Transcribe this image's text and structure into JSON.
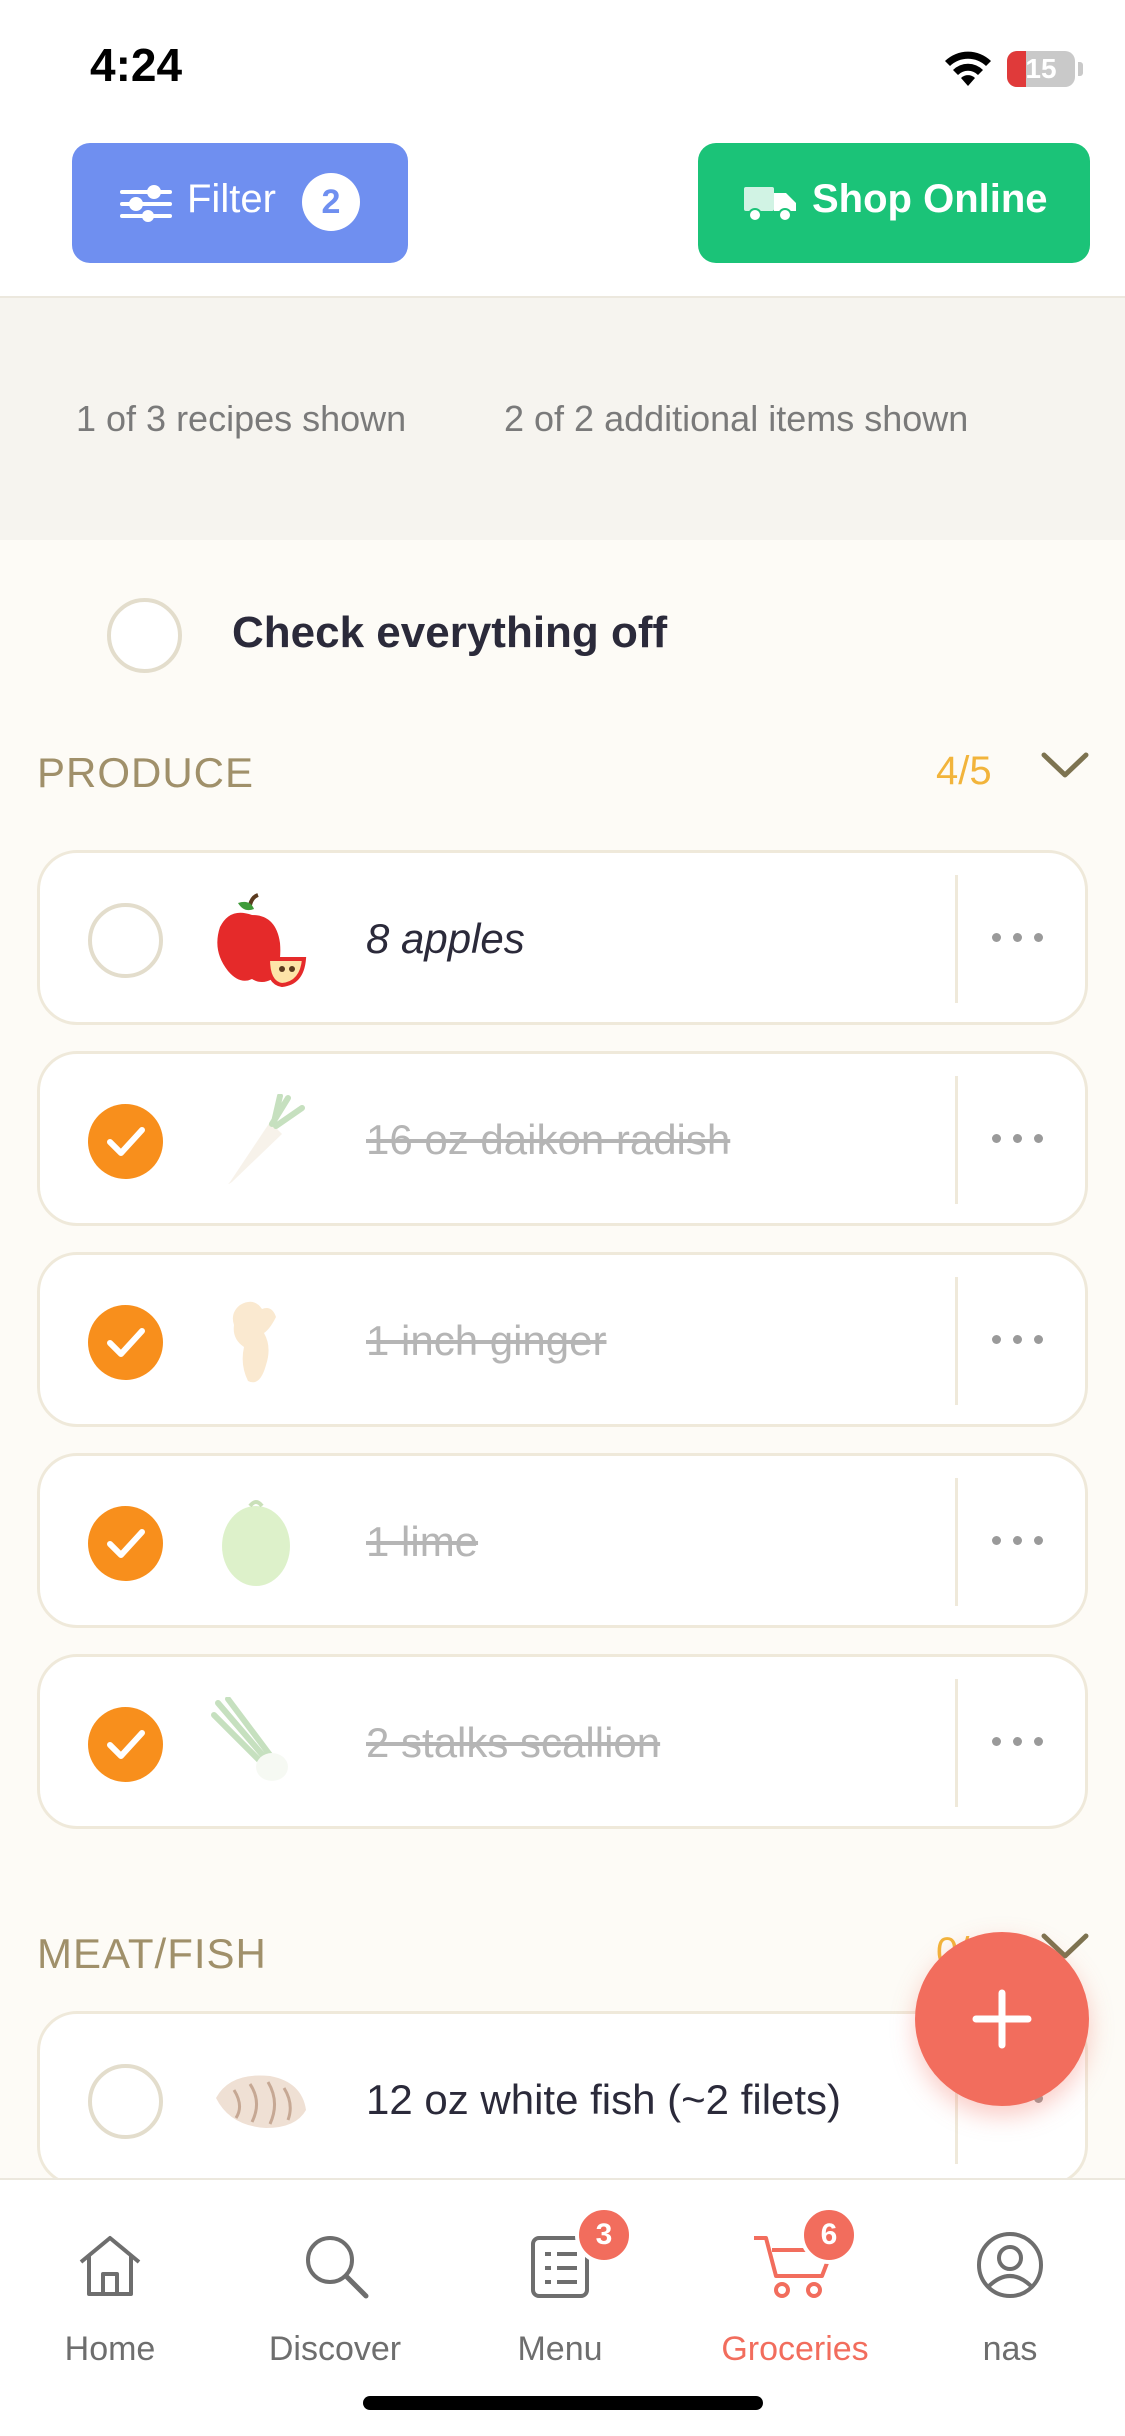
{
  "status_bar": {
    "time": "4:24",
    "battery_level": "15"
  },
  "toolbar": {
    "filter_label": "Filter",
    "filter_count": "2",
    "shop_label": "Shop Online"
  },
  "summary": {
    "recipes_shown": "1 of 3 recipes shown",
    "items_shown": "2 of 2 additional items shown"
  },
  "check_all_label": "Check everything off",
  "sections": [
    {
      "title": "PRODUCE",
      "count": "4/5",
      "items": [
        {
          "label": "8 apples",
          "checked": false,
          "icon": "apple-icon"
        },
        {
          "label": "16 oz daikon radish",
          "checked": true,
          "icon": "daikon-radish-icon"
        },
        {
          "label": "1 inch ginger",
          "checked": true,
          "icon": "ginger-icon"
        },
        {
          "label": "1 lime",
          "checked": true,
          "icon": "lime-icon"
        },
        {
          "label": "2 stalks scallion",
          "checked": true,
          "icon": "scallion-icon"
        }
      ]
    },
    {
      "title": "MEAT/FISH",
      "count": "0/1",
      "items": [
        {
          "label": "12 oz white fish (~2 filets)",
          "checked": false,
          "icon": "fish-fillet-icon"
        }
      ]
    }
  ],
  "tabs": [
    {
      "label": "Home",
      "icon": "home-icon",
      "active": false
    },
    {
      "label": "Discover",
      "icon": "search-icon",
      "active": false
    },
    {
      "label": "Menu",
      "icon": "menu-list-icon",
      "badge": "3",
      "active": false
    },
    {
      "label": "Groceries",
      "icon": "cart-icon",
      "badge": "6",
      "active": true
    },
    {
      "label": "nas",
      "icon": "profile-icon",
      "active": false
    }
  ],
  "colors": {
    "accent": "#f26d5d",
    "filter_button": "#6f8ff0",
    "shop_button": "#1bc378",
    "check_orange": "#f88f1c",
    "section_count": "#f2b43b"
  }
}
